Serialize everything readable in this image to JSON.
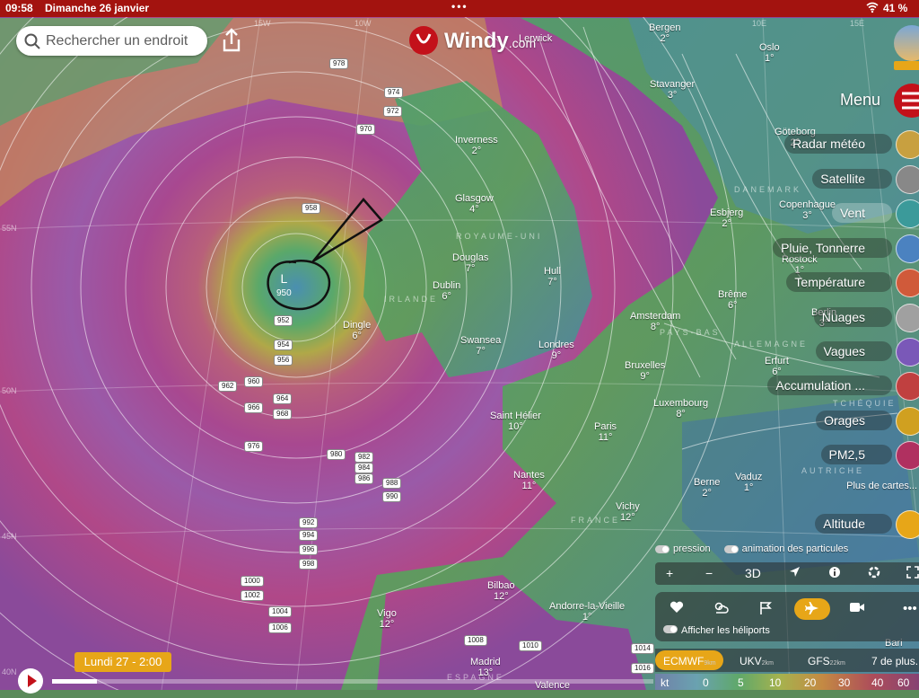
{
  "status_bar": {
    "time": "09:58",
    "date": "Dimanche 26 janvier",
    "battery": "41 %"
  },
  "search": {
    "placeholder": "Rechercher un endroit"
  },
  "logo": {
    "name": "Windy",
    "suffix": ".com"
  },
  "menu": {
    "label": "Menu"
  },
  "layers": [
    {
      "label": "Radar météo",
      "color": "#c8a040"
    },
    {
      "label": "Satellite",
      "color": "#888888"
    },
    {
      "label": "Vent",
      "color": "#3b9a9a"
    },
    {
      "label": "Pluie, Tonnerre",
      "color": "#4b82c0"
    },
    {
      "label": "Température",
      "color": "#d05a3a"
    },
    {
      "label": "Nuages",
      "color": "#a0a0a0"
    },
    {
      "label": "Vagues",
      "color": "#7a58b8"
    },
    {
      "label": "Accumulation ...",
      "color": "#c04040"
    },
    {
      "label": "Orages",
      "color": "#d0a020"
    },
    {
      "label": "PM2,5",
      "color": "#b03060"
    }
  ],
  "more_maps": "Plus de cartes...",
  "altitude": {
    "label": "Altitude"
  },
  "toggles": {
    "pressure": "pression",
    "particles": "animation des particules"
  },
  "toolbar": {
    "zoom_in": "+",
    "zoom_out": "−",
    "view3d": "3D"
  },
  "panel": {
    "helicopters": "Afficher les héliports"
  },
  "models": [
    {
      "name": "ECMWF",
      "res": "9km"
    },
    {
      "name": "UKV",
      "res": "2km"
    },
    {
      "name": "GFS",
      "res": "22km"
    },
    {
      "name": "7 de plus.",
      "res": ""
    }
  ],
  "scale": {
    "unit": "kt",
    "values": [
      "0",
      "5",
      "10",
      "20",
      "30",
      "40",
      "60"
    ]
  },
  "time_label": "Lundi 27 - 2:00",
  "low": {
    "symbol": "L",
    "value": "950"
  },
  "cities": [
    {
      "name": "Lerwick",
      "temp": ""
    },
    {
      "name": "Bergen",
      "temp": "2°"
    },
    {
      "name": "Oslo",
      "temp": "1°"
    },
    {
      "name": "Stavanger",
      "temp": "3°"
    },
    {
      "name": "Göteborg",
      "temp": "2°"
    },
    {
      "name": "Inverness",
      "temp": "2°"
    },
    {
      "name": "Glasgow",
      "temp": "4°"
    },
    {
      "name": "Esbjerg",
      "temp": "2°"
    },
    {
      "name": "Copenhague",
      "temp": "3°"
    },
    {
      "name": "Rostock",
      "temp": "1°"
    },
    {
      "name": "Douglas",
      "temp": "7°"
    },
    {
      "name": "Dublin",
      "temp": "6°"
    },
    {
      "name": "Hull",
      "temp": "7°"
    },
    {
      "name": "Brême",
      "temp": "6°"
    },
    {
      "name": "Berlin",
      "temp": "3°"
    },
    {
      "name": "Dingle",
      "temp": "6°"
    },
    {
      "name": "Amsterdam",
      "temp": "8°"
    },
    {
      "name": "Swansea",
      "temp": "7°"
    },
    {
      "name": "Londres",
      "temp": "9°"
    },
    {
      "name": "Bruxelles",
      "temp": "9°"
    },
    {
      "name": "Erfurt",
      "temp": "6°"
    },
    {
      "name": "Luxembourg",
      "temp": "8°"
    },
    {
      "name": "Saint Hélier",
      "temp": "10°"
    },
    {
      "name": "Paris",
      "temp": "11°"
    },
    {
      "name": "Nantes",
      "temp": "11°"
    },
    {
      "name": "Berne",
      "temp": "2°"
    },
    {
      "name": "Vaduz",
      "temp": "1°"
    },
    {
      "name": "Vichy",
      "temp": "12°"
    },
    {
      "name": "Bilbao",
      "temp": "12°"
    },
    {
      "name": "Andorre-la-Vieille",
      "temp": "1°"
    },
    {
      "name": "Vigo",
      "temp": "12°"
    },
    {
      "name": "Madrid",
      "temp": "13°"
    },
    {
      "name": "Bari",
      "temp": ""
    },
    {
      "name": "Valence",
      "temp": ""
    }
  ],
  "countries": [
    "ROYAUME-UNI",
    "IRLANDE",
    "DANEMARK",
    "PAYS-BAS",
    "ALLEMAGNE",
    "TCHÉQUIE",
    "AUTRICHE",
    "FRANCE",
    "ESPAGNE"
  ],
  "isobars": [
    "978",
    "974",
    "972",
    "970",
    "958",
    "952",
    "954",
    "956",
    "960",
    "962",
    "964",
    "966",
    "968",
    "976",
    "980",
    "982",
    "984",
    "986",
    "988",
    "990",
    "992",
    "994",
    "996",
    "998",
    "1000",
    "1002",
    "1004",
    "1006",
    "1008",
    "1010",
    "1014",
    "1016"
  ],
  "grid_labels": [
    "15W",
    "10W",
    "10E",
    "15E",
    "55N",
    "50N",
    "45N",
    "40N"
  ]
}
